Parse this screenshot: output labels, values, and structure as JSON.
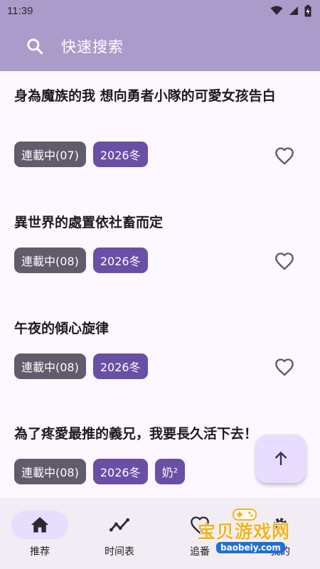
{
  "status_bar": {
    "time": "11:39"
  },
  "search": {
    "label": "快速搜索"
  },
  "items": [
    {
      "title": "身為魔族的我 想向勇者小隊的可愛女孩告白",
      "status": "連載中(07)",
      "season": "2026冬"
    },
    {
      "title": "異世界的處置依社畜而定",
      "status": "連載中(08)",
      "season": "2026冬"
    },
    {
      "title": "午夜的傾心旋律",
      "status": "連載中(08)",
      "season": "2026冬"
    },
    {
      "title": "為了疼愛最推的義兄，我要長久活下去！",
      "status": "連載中(08)",
      "season": "2026冬",
      "extra": "奶²"
    }
  ],
  "nav": [
    {
      "label": "推荐",
      "icon": "home-icon",
      "active": true
    },
    {
      "label": "时间表",
      "icon": "trending-icon",
      "active": false
    },
    {
      "label": "追番",
      "icon": "heart-icon",
      "active": false
    },
    {
      "label": "我的",
      "icon": "gear-icon",
      "active": false
    }
  ],
  "watermark": {
    "text": "宝贝游戏网",
    "url": "baobeiy.com"
  },
  "colors": {
    "app_bar": "#ab9bca",
    "season_tag": "#6a4fa6",
    "status_tag": "#615b6b",
    "background": "#fdf7ff"
  }
}
